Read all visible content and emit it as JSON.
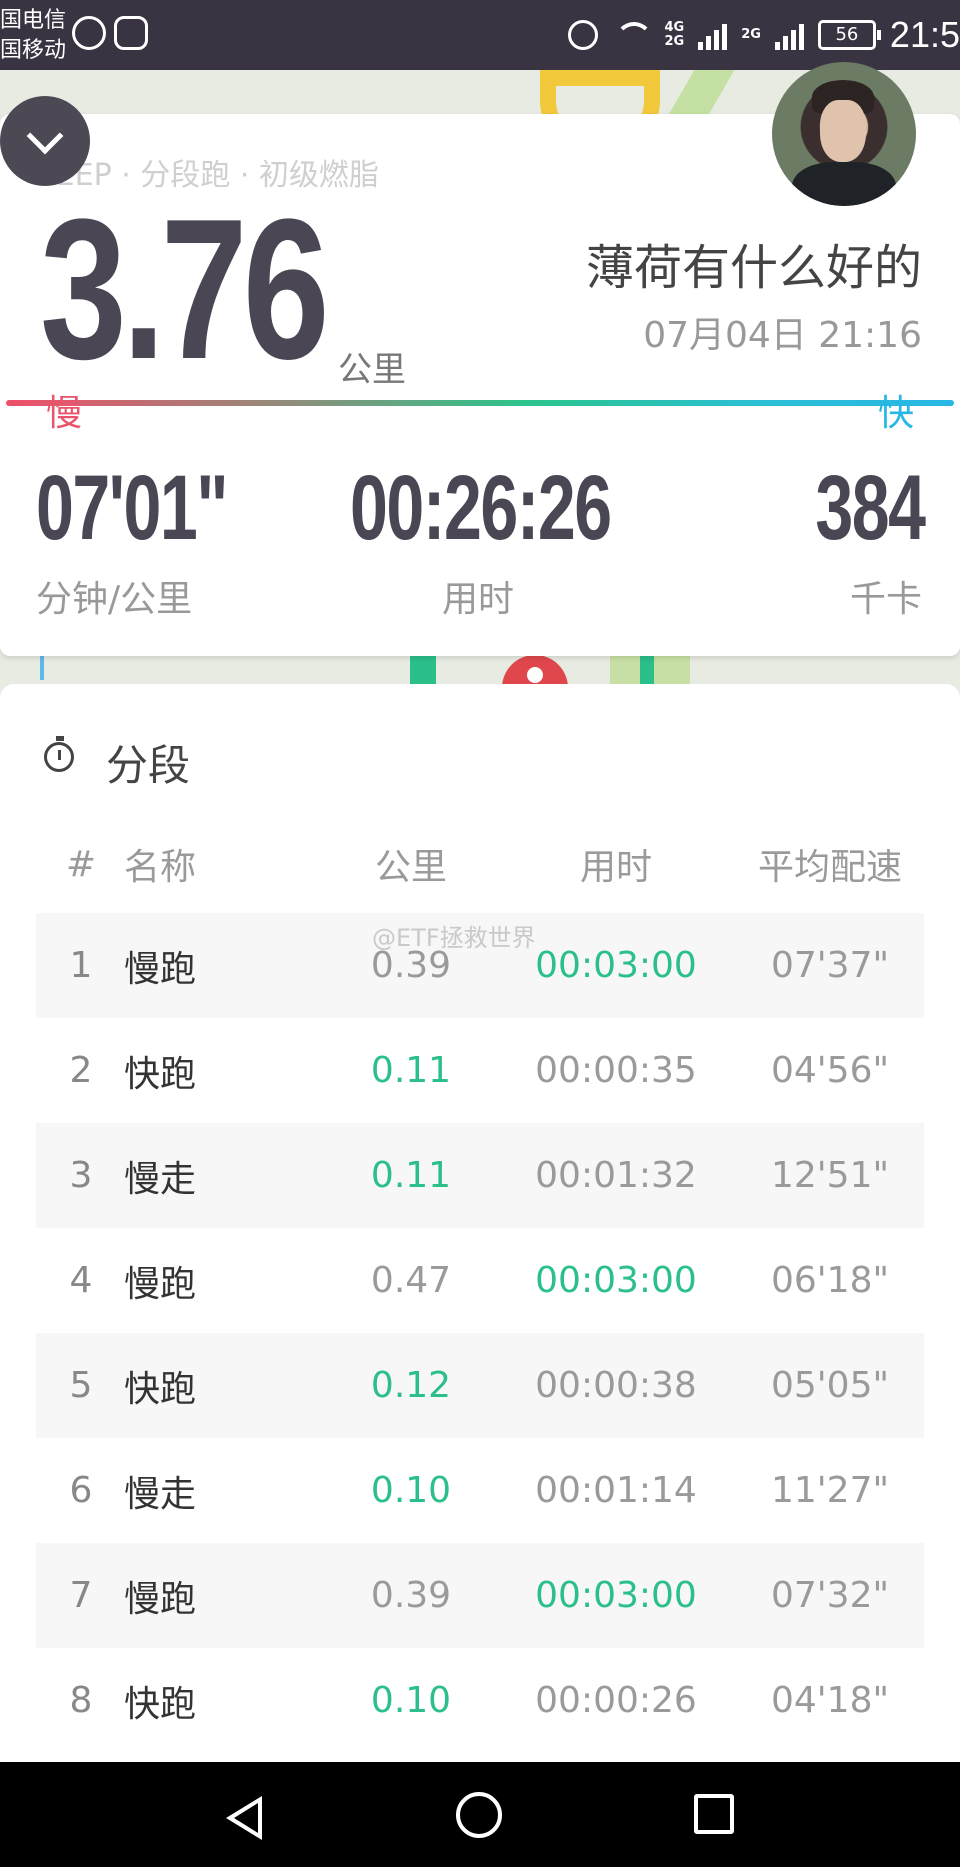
{
  "status_bar": {
    "carrier_1": "国电信",
    "carrier_2": "国移动",
    "network_top": "4G",
    "network_bottom": "2G",
    "network_2": "2G",
    "battery": "56",
    "time": "21:5"
  },
  "summary": {
    "course": "KEEP · 分段跑 · 初级燃脂",
    "distance": "3.76",
    "distance_unit": "公里",
    "title": "薄荷有什么好的",
    "datetime": "07月04日 21:16",
    "slow_label": "慢",
    "fast_label": "快",
    "pace": "07'01\"",
    "pace_label": "分钟/公里",
    "duration": "00:26:26",
    "duration_label": "用时",
    "calories": "384",
    "calories_label": "千卡"
  },
  "splits": {
    "title": "分段",
    "headers": {
      "num": "#",
      "name": "名称",
      "km": "公里",
      "time": "用时",
      "pace": "平均配速"
    },
    "rows": [
      {
        "num": "1",
        "name": "慢跑",
        "km": "0.39",
        "time": "00:03:00",
        "pace": "07'37\""
      },
      {
        "num": "2",
        "name": "快跑",
        "km": "0.11",
        "time": "00:00:35",
        "pace": "04'56\""
      },
      {
        "num": "3",
        "name": "慢走",
        "km": "0.11",
        "time": "00:01:32",
        "pace": "12'51\""
      },
      {
        "num": "4",
        "name": "慢跑",
        "km": "0.47",
        "time": "00:03:00",
        "pace": "06'18\""
      },
      {
        "num": "5",
        "name": "快跑",
        "km": "0.12",
        "time": "00:00:38",
        "pace": "05'05\""
      },
      {
        "num": "6",
        "name": "慢走",
        "km": "0.10",
        "time": "00:01:14",
        "pace": "11'27\""
      },
      {
        "num": "7",
        "name": "慢跑",
        "km": "0.39",
        "time": "00:03:00",
        "pace": "07'32\""
      },
      {
        "num": "8",
        "name": "快跑",
        "km": "0.10",
        "time": "00:00:26",
        "pace": "04'18\""
      }
    ]
  },
  "watermark": "@ETF拯救世界",
  "colors": {
    "accent_green": "#2bbf8a",
    "slow_red": "#e9546b",
    "fast_blue": "#27b7e4",
    "dark_text": "#4b4654"
  }
}
